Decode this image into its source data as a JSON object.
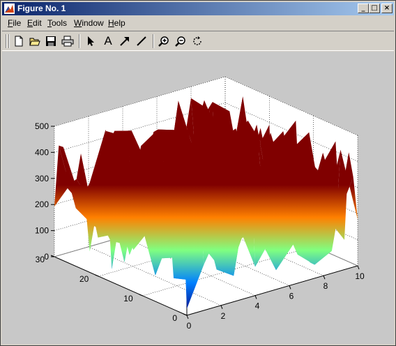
{
  "window": {
    "title": "Figure No. 1",
    "controls": {
      "minimize": "_",
      "maximize": "□",
      "close": "×"
    }
  },
  "menu": {
    "items": [
      {
        "label": "File",
        "accel": "F",
        "rest": "ile"
      },
      {
        "label": "Edit",
        "accel": "E",
        "rest": "dit"
      },
      {
        "label": "Tools",
        "accel": "T",
        "rest": "ools"
      },
      {
        "label": "Window",
        "accel": "W",
        "rest": "indow"
      },
      {
        "label": "Help",
        "accel": "H",
        "rest": "elp"
      }
    ]
  },
  "toolbar": {
    "icons": [
      "new-file-icon",
      "open-folder-icon",
      "save-icon",
      "print-icon",
      "select-arrow-icon",
      "insert-text-icon",
      "insert-arrow-icon",
      "insert-line-icon",
      "zoom-in-icon",
      "zoom-out-icon",
      "rotate-3d-icon"
    ],
    "text_tool_glyph": "A"
  },
  "chart_data": {
    "type": "surface",
    "colormap": "jet",
    "x_ticks": [
      "0",
      "2",
      "4",
      "6",
      "8",
      "10"
    ],
    "y_ticks": [
      "0",
      "10",
      "20",
      "30"
    ],
    "z_ticks": [
      "0",
      "100",
      "200",
      "300",
      "400",
      "500"
    ],
    "xlim": [
      0,
      10
    ],
    "ylim": [
      0,
      30
    ],
    "zlim": [
      0,
      500
    ],
    "grid": true,
    "note_values": "random surface heights between about 0 and 500"
  }
}
